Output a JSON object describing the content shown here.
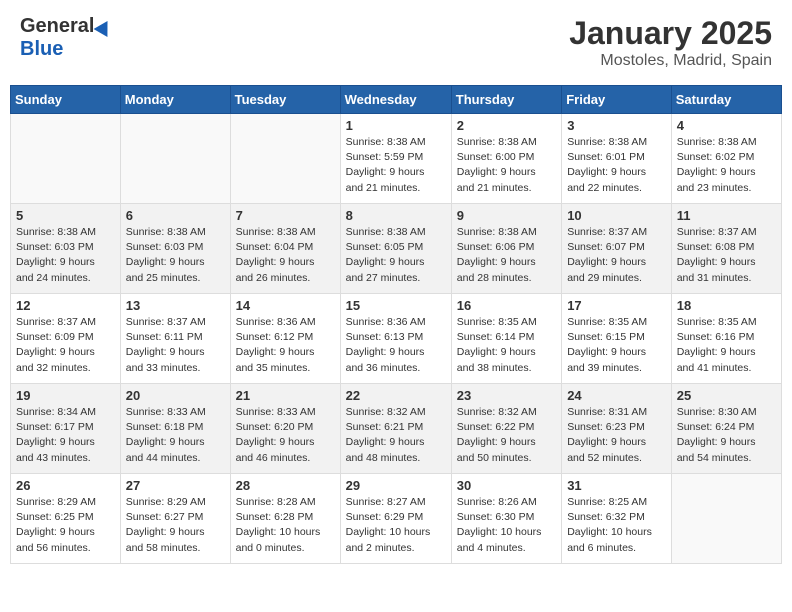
{
  "header": {
    "logo_general": "General",
    "logo_blue": "Blue",
    "month_title": "January 2025",
    "location": "Mostoles, Madrid, Spain"
  },
  "calendar": {
    "days_of_week": [
      "Sunday",
      "Monday",
      "Tuesday",
      "Wednesday",
      "Thursday",
      "Friday",
      "Saturday"
    ],
    "weeks": [
      [
        {
          "num": "",
          "info": ""
        },
        {
          "num": "",
          "info": ""
        },
        {
          "num": "",
          "info": ""
        },
        {
          "num": "1",
          "info": "Sunrise: 8:38 AM\nSunset: 5:59 PM\nDaylight: 9 hours\nand 21 minutes."
        },
        {
          "num": "2",
          "info": "Sunrise: 8:38 AM\nSunset: 6:00 PM\nDaylight: 9 hours\nand 21 minutes."
        },
        {
          "num": "3",
          "info": "Sunrise: 8:38 AM\nSunset: 6:01 PM\nDaylight: 9 hours\nand 22 minutes."
        },
        {
          "num": "4",
          "info": "Sunrise: 8:38 AM\nSunset: 6:02 PM\nDaylight: 9 hours\nand 23 minutes."
        }
      ],
      [
        {
          "num": "5",
          "info": "Sunrise: 8:38 AM\nSunset: 6:03 PM\nDaylight: 9 hours\nand 24 minutes."
        },
        {
          "num": "6",
          "info": "Sunrise: 8:38 AM\nSunset: 6:03 PM\nDaylight: 9 hours\nand 25 minutes."
        },
        {
          "num": "7",
          "info": "Sunrise: 8:38 AM\nSunset: 6:04 PM\nDaylight: 9 hours\nand 26 minutes."
        },
        {
          "num": "8",
          "info": "Sunrise: 8:38 AM\nSunset: 6:05 PM\nDaylight: 9 hours\nand 27 minutes."
        },
        {
          "num": "9",
          "info": "Sunrise: 8:38 AM\nSunset: 6:06 PM\nDaylight: 9 hours\nand 28 minutes."
        },
        {
          "num": "10",
          "info": "Sunrise: 8:37 AM\nSunset: 6:07 PM\nDaylight: 9 hours\nand 29 minutes."
        },
        {
          "num": "11",
          "info": "Sunrise: 8:37 AM\nSunset: 6:08 PM\nDaylight: 9 hours\nand 31 minutes."
        }
      ],
      [
        {
          "num": "12",
          "info": "Sunrise: 8:37 AM\nSunset: 6:09 PM\nDaylight: 9 hours\nand 32 minutes."
        },
        {
          "num": "13",
          "info": "Sunrise: 8:37 AM\nSunset: 6:11 PM\nDaylight: 9 hours\nand 33 minutes."
        },
        {
          "num": "14",
          "info": "Sunrise: 8:36 AM\nSunset: 6:12 PM\nDaylight: 9 hours\nand 35 minutes."
        },
        {
          "num": "15",
          "info": "Sunrise: 8:36 AM\nSunset: 6:13 PM\nDaylight: 9 hours\nand 36 minutes."
        },
        {
          "num": "16",
          "info": "Sunrise: 8:35 AM\nSunset: 6:14 PM\nDaylight: 9 hours\nand 38 minutes."
        },
        {
          "num": "17",
          "info": "Sunrise: 8:35 AM\nSunset: 6:15 PM\nDaylight: 9 hours\nand 39 minutes."
        },
        {
          "num": "18",
          "info": "Sunrise: 8:35 AM\nSunset: 6:16 PM\nDaylight: 9 hours\nand 41 minutes."
        }
      ],
      [
        {
          "num": "19",
          "info": "Sunrise: 8:34 AM\nSunset: 6:17 PM\nDaylight: 9 hours\nand 43 minutes."
        },
        {
          "num": "20",
          "info": "Sunrise: 8:33 AM\nSunset: 6:18 PM\nDaylight: 9 hours\nand 44 minutes."
        },
        {
          "num": "21",
          "info": "Sunrise: 8:33 AM\nSunset: 6:20 PM\nDaylight: 9 hours\nand 46 minutes."
        },
        {
          "num": "22",
          "info": "Sunrise: 8:32 AM\nSunset: 6:21 PM\nDaylight: 9 hours\nand 48 minutes."
        },
        {
          "num": "23",
          "info": "Sunrise: 8:32 AM\nSunset: 6:22 PM\nDaylight: 9 hours\nand 50 minutes."
        },
        {
          "num": "24",
          "info": "Sunrise: 8:31 AM\nSunset: 6:23 PM\nDaylight: 9 hours\nand 52 minutes."
        },
        {
          "num": "25",
          "info": "Sunrise: 8:30 AM\nSunset: 6:24 PM\nDaylight: 9 hours\nand 54 minutes."
        }
      ],
      [
        {
          "num": "26",
          "info": "Sunrise: 8:29 AM\nSunset: 6:25 PM\nDaylight: 9 hours\nand 56 minutes."
        },
        {
          "num": "27",
          "info": "Sunrise: 8:29 AM\nSunset: 6:27 PM\nDaylight: 9 hours\nand 58 minutes."
        },
        {
          "num": "28",
          "info": "Sunrise: 8:28 AM\nSunset: 6:28 PM\nDaylight: 10 hours\nand 0 minutes."
        },
        {
          "num": "29",
          "info": "Sunrise: 8:27 AM\nSunset: 6:29 PM\nDaylight: 10 hours\nand 2 minutes."
        },
        {
          "num": "30",
          "info": "Sunrise: 8:26 AM\nSunset: 6:30 PM\nDaylight: 10 hours\nand 4 minutes."
        },
        {
          "num": "31",
          "info": "Sunrise: 8:25 AM\nSunset: 6:32 PM\nDaylight: 10 hours\nand 6 minutes."
        },
        {
          "num": "",
          "info": ""
        }
      ]
    ]
  }
}
